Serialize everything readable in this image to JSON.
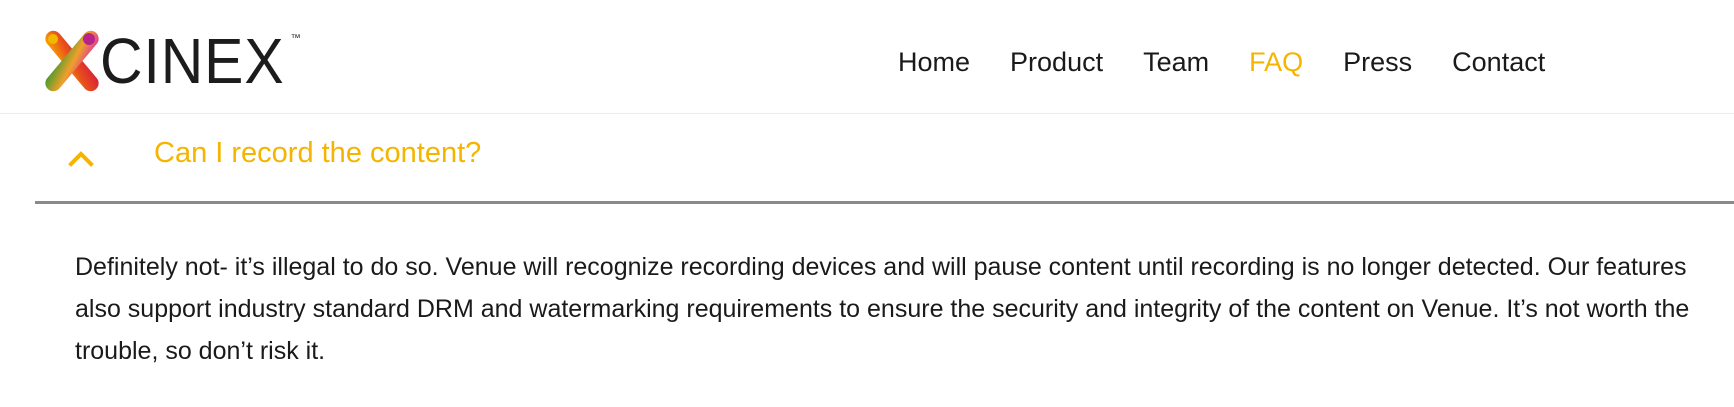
{
  "header": {
    "logo": {
      "text": "CINEX",
      "tm": "™"
    },
    "nav": [
      {
        "label": "Home",
        "active": false
      },
      {
        "label": "Product",
        "active": false
      },
      {
        "label": "Team",
        "active": false
      },
      {
        "label": "FAQ",
        "active": true
      },
      {
        "label": "Press",
        "active": false
      },
      {
        "label": "Contact",
        "active": false
      }
    ]
  },
  "faq": {
    "question": "Can I record the content?",
    "expanded": true,
    "toggle_icon": "chevron-up-icon",
    "answer": "Definitely not- it’s illegal to do so. Venue will recognize recording devices and will pause content until recording is no longer detected. Our features also support industry standard DRM and watermarking requirements to ensure the security and integrity of the content on Venue. It’s not worth the trouble, so don’t risk it."
  },
  "colors": {
    "accent": "#f5b400",
    "text": "#1a1a1a",
    "divider": "#8a8a8a"
  }
}
